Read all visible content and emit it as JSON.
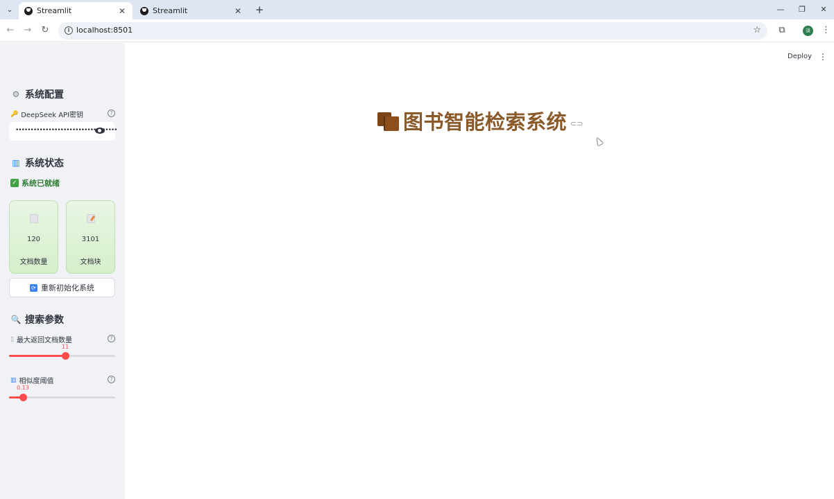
{
  "browser": {
    "tabs": [
      {
        "title": "Streamlit",
        "active": true
      },
      {
        "title": "Streamlit",
        "active": false
      }
    ],
    "url": "localhost:8501",
    "profile_initial": "淡"
  },
  "header": {
    "deploy_label": "Deploy"
  },
  "sidebar": {
    "config": {
      "title": "系统配置",
      "api_key_label": "DeepSeek API密钥",
      "api_key_masked": "••••••••••••••••••••••••••••••••••"
    },
    "status": {
      "title": "系统状态",
      "ready_text": "系统已就绪",
      "metrics": [
        {
          "value": "120",
          "label": "文档数量"
        },
        {
          "value": "3101",
          "label": "文档块"
        }
      ],
      "reinit_label": "重新初始化系统"
    },
    "search": {
      "title": "搜索参数",
      "max_docs": {
        "label": "最大返回文档数量",
        "value": "11",
        "fraction": 0.53
      },
      "similarity": {
        "label": "相似度阈值",
        "value": "0.13",
        "fraction": 0.13
      }
    }
  },
  "main": {
    "title": "图书智能检索系统"
  },
  "colors": {
    "accent": "#ff4b4b",
    "title": "#8b5a2b",
    "sidebar_bg": "#f0f2f6",
    "success": "#2e7d32"
  }
}
